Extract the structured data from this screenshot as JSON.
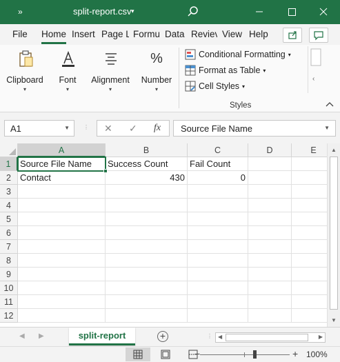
{
  "titlebar": {
    "qat_label": "»",
    "title": "split-report.csv",
    "title_caret": "▾",
    "bg_color": "#217346"
  },
  "tabs": [
    {
      "label": "File"
    },
    {
      "label": "Home",
      "active": true
    },
    {
      "label": "Insert"
    },
    {
      "label": "Page L"
    },
    {
      "label": "Formu"
    },
    {
      "label": "Data"
    },
    {
      "label": "Reviev"
    },
    {
      "label": "View"
    },
    {
      "label": "Help"
    }
  ],
  "ribbon": {
    "clipboard": "Clipboard",
    "font": "Font",
    "alignment": "Alignment",
    "number": "Number",
    "number_icon": "%",
    "conditional_formatting": "Conditional Formatting",
    "format_as_table": "Format as Table",
    "cell_styles": "Cell Styles",
    "styles_group": "Styles"
  },
  "formula_bar": {
    "name_box": "A1",
    "fx_label": "fx",
    "cancel_glyph": "✕",
    "enter_glyph": "✓",
    "formula": "Source File Name"
  },
  "grid": {
    "columns": [
      "A",
      "B",
      "C",
      "D",
      "E"
    ],
    "rows": [
      "1",
      "2",
      "3",
      "4",
      "5",
      "6",
      "7",
      "8",
      "9",
      "10",
      "11",
      "12"
    ],
    "cells": {
      "A1": "Source File Name",
      "B1": "Success Count",
      "C1": "Fail Count",
      "A2": "Contact",
      "B2": "430",
      "C2": "0"
    },
    "selected_cell": "A1"
  },
  "sheets": [
    {
      "label": "split-report",
      "active": true
    }
  ],
  "statusbar": {
    "zoom_level": "100%",
    "zoom_minus": "−",
    "zoom_plus": "+"
  }
}
